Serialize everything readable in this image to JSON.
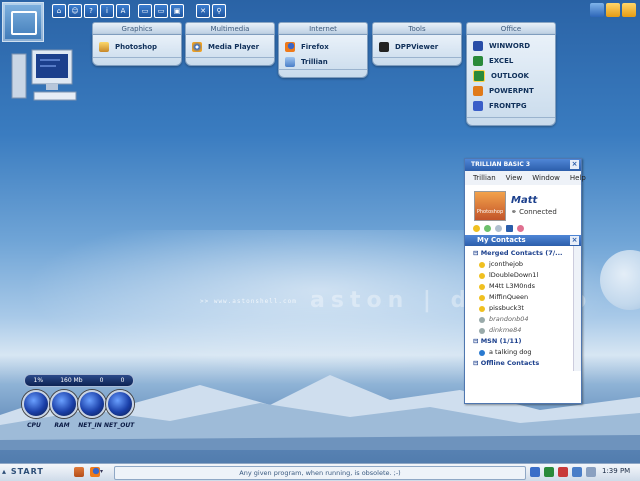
{
  "desktop": {
    "brand_small": ">> www.astonshell.com",
    "brand_large": "aston | desktop"
  },
  "categories": [
    {
      "label": "Graphics",
      "items": [
        {
          "label": "Photoshop",
          "icon": "photoshop-icon"
        }
      ]
    },
    {
      "label": "Multimedia",
      "items": [
        {
          "label": "Media Player",
          "icon": "media-player-icon"
        }
      ]
    },
    {
      "label": "Internet",
      "items": [
        {
          "label": "Firefox",
          "icon": "firefox-icon"
        },
        {
          "label": "Trillian",
          "icon": "trillian-icon"
        }
      ]
    },
    {
      "label": "Tools",
      "items": [
        {
          "label": "DPPViewer",
          "icon": "camera-icon"
        }
      ]
    },
    {
      "label": "Office",
      "items": [
        {
          "label": "WINWORD",
          "icon": "word-icon"
        },
        {
          "label": "EXCEL",
          "icon": "excel-icon"
        },
        {
          "label": "OUTLOOK",
          "icon": "outlook-icon"
        },
        {
          "label": "POWERPNT",
          "icon": "powerpoint-icon"
        },
        {
          "label": "FRONTPG",
          "icon": "frontpage-icon"
        }
      ]
    }
  ],
  "trillian": {
    "title": "TRILLIAN BASIC 3",
    "menu": [
      "Trillian",
      "View",
      "Window",
      "Help"
    ],
    "user_name": "Matt",
    "user_status": "Connected",
    "avatar_text": "Photoshop",
    "section_title": "My Contacts",
    "groups": [
      {
        "label": "Merged Contacts (7/...",
        "contacts": [
          "jconthejob",
          "lDoubleDown1l",
          "M4tt L3M0nds",
          "MiffinQueen",
          "pissbuck3t",
          "brandonb04",
          "dinkme84"
        ]
      },
      {
        "label": "MSN (1/11)",
        "contacts": [
          "a talking dog"
        ]
      },
      {
        "label": "Offline Contacts",
        "contacts": []
      }
    ]
  },
  "meters": {
    "cpu_value": "1%",
    "ram_value": "160 Mb",
    "net_in_value": "0",
    "net_out_value": "0",
    "labels": [
      "CPU",
      "RAM",
      "NET_IN",
      "NET_OUT"
    ]
  },
  "taskbar": {
    "start_label": "START",
    "status_text": "Any given program, when running, is obsolete. ;-)",
    "clock": "1:39 PM"
  },
  "colors": {
    "accent": "#2c5eab",
    "panel_bg": "#d9e6f3",
    "sky_top": "#2a63a6"
  }
}
